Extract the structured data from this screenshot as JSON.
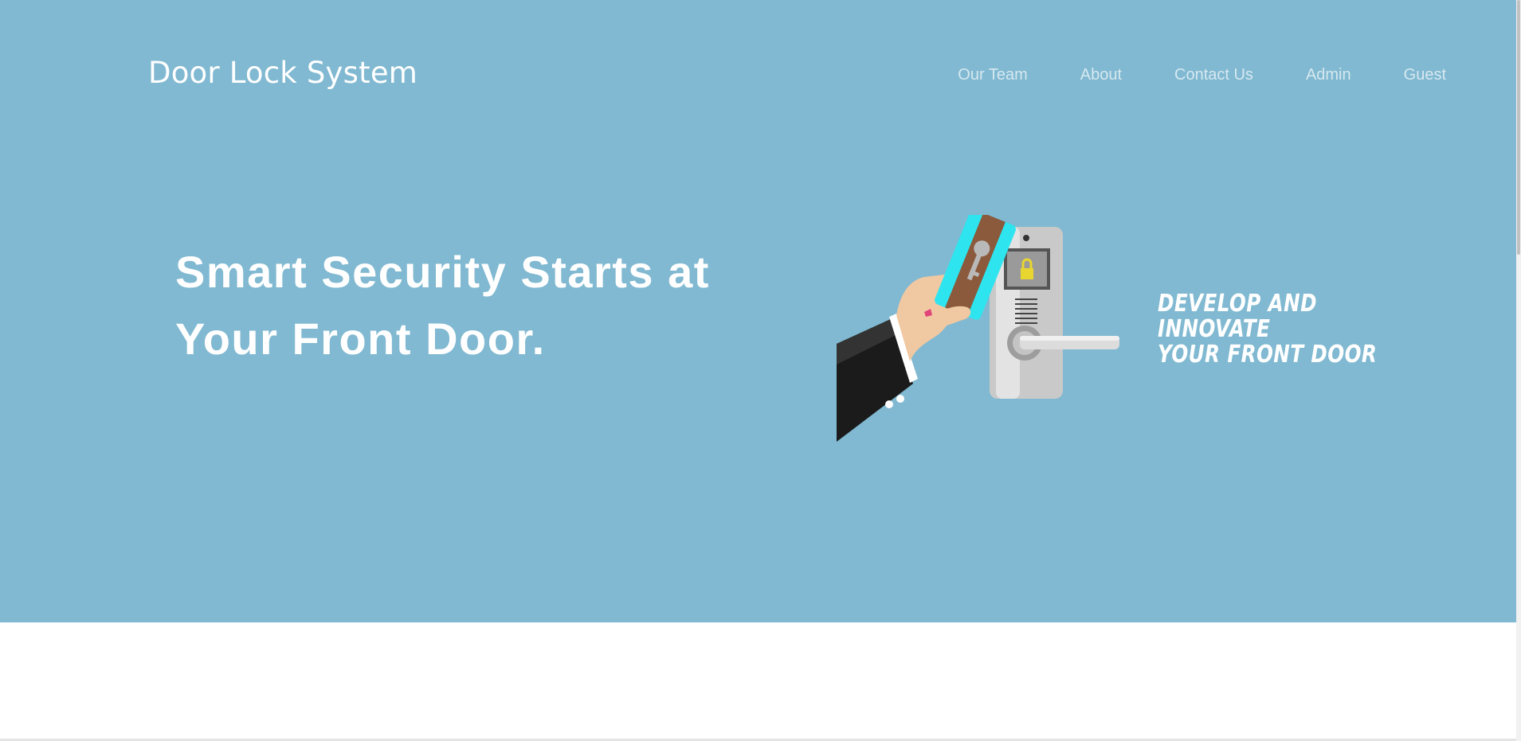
{
  "header": {
    "brand": "Door Lock System",
    "nav": [
      {
        "label": "Our Team"
      },
      {
        "label": "About"
      },
      {
        "label": "Contact Us"
      },
      {
        "label": "Admin"
      },
      {
        "label": "Guest"
      }
    ]
  },
  "hero": {
    "headline_line1": "Smart Security Starts at",
    "headline_line2": "Your Front Door.",
    "tagline_line1": "DEVELOP AND INNOVATE",
    "tagline_line2": "YOUR FRONT DOOR",
    "illustration": "hand-card-door-lock-illustration"
  },
  "colors": {
    "hero_bg": "#80b9d1",
    "text": "#ffffff",
    "nav_text": "#d6e8f0",
    "card": "#2ee5ef",
    "card_stripe": "#8b5a3c"
  }
}
